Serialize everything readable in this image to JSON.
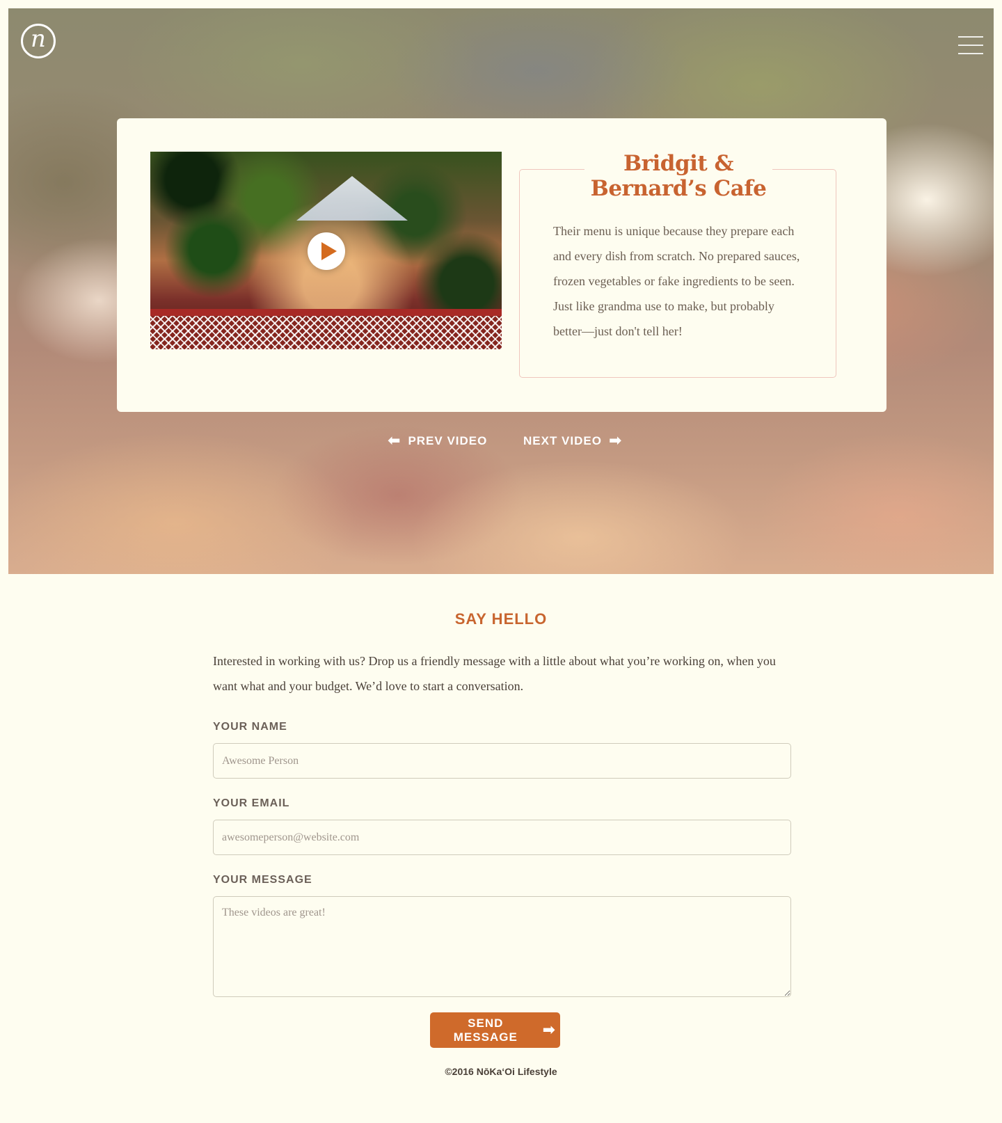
{
  "brand": {
    "logo_letter": "n",
    "logo_icon": "logo-icon"
  },
  "header": {
    "menu_icon": "hamburger-menu-icon"
  },
  "video_card": {
    "title_line1": "Bridgit &",
    "title_line2": "Bernard’s Cafe",
    "description": "Their menu is unique because they prepare each and every dish from scratch. No prepared sauces, frozen vegetables or fake ingredients to be seen. Just like grandma use to make, but probably better—just don't tell her!",
    "play_icon": "play-icon"
  },
  "video_nav": {
    "prev_label": "PREV VIDEO",
    "next_label": "NEXT VIDEO",
    "prev_icon": "arrow-left-icon",
    "next_icon": "arrow-right-icon"
  },
  "contact": {
    "title": "SAY HELLO",
    "intro": "Interested in working with us? Drop us a friendly message with a little about what you’re working on, when you want what and your budget. We’d love to start a conversation.",
    "fields": {
      "name_label": "YOUR NAME",
      "name_placeholder": "Awesome Person",
      "email_label": "YOUR EMAIL",
      "email_placeholder": "awesomeperson@website.com",
      "message_label": "YOUR MESSAGE",
      "message_placeholder": "These videos are great!"
    },
    "send_label": "SEND MESSAGE",
    "send_icon": "arrow-right-icon"
  },
  "footer": {
    "copyright": "©2016 NōKa‘Oi Lifestyle"
  },
  "colors": {
    "accent": "#cf6a2b",
    "background": "#fefdf0",
    "text": "#4a4038"
  }
}
